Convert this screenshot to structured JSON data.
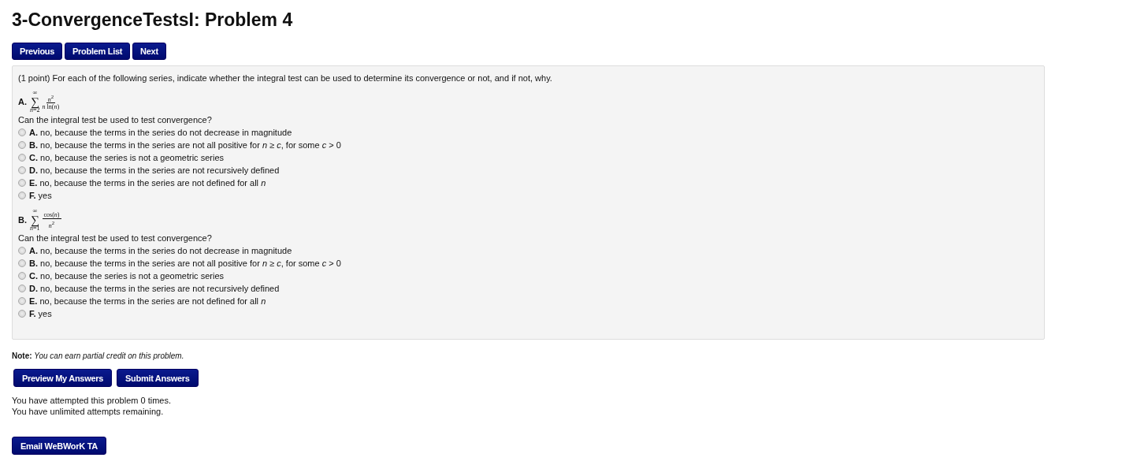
{
  "title": "3-ConvergenceTestsI: Problem 4",
  "nav_buttons": [
    "Previous",
    "Problem List",
    "Next"
  ],
  "problem": {
    "intro": "(1 point) For each of the following series, indicate whether the integral test can be used to determine its convergence or not, and if not, why.",
    "parts": [
      {
        "label": "A.",
        "symbol": "∑",
        "sum_top": "∞",
        "sum_bottom": "*n*=2",
        "numerator": "*n*$^{2}$",
        "denominator": "*n* ln(*n*)",
        "question": "Can the integral test be used to test convergence?",
        "options": [
          {
            "text": "**A.** no, because the terms in the series do not decrease in magnitude",
            "selected": false
          },
          {
            "text": "**B.** no, because the terms in the series are not all positive for *n* ≥ *c*, for some *c* > 0",
            "selected": false
          },
          {
            "text": "**C.** no, because the series is not a geometric series",
            "selected": false
          },
          {
            "text": "**D.** no, because the terms in the series are not recursively defined",
            "selected": false
          },
          {
            "text": "**E.** no, because the terms in the series are not defined for all *n*",
            "selected": false
          },
          {
            "text": "**F.** yes",
            "selected": false
          }
        ]
      },
      {
        "label": "B.",
        "symbol": "∑",
        "sum_top": "∞",
        "sum_bottom": "*n*=1",
        "numerator": "cos(*n*)",
        "denominator": "*n*$^{2}$",
        "question": "Can the integral test be used to test convergence?",
        "options": [
          {
            "text": "**A.** no, because the terms in the series do not decrease in magnitude",
            "selected": false
          },
          {
            "text": "**B.** no, because the terms in the series are not all positive for *n* ≥ *c*, for some *c* > 0",
            "selected": false
          },
          {
            "text": "**C.** no, because the series is not a geometric series",
            "selected": false
          },
          {
            "text": "**D.** no, because the terms in the series are not recursively defined",
            "selected": false
          },
          {
            "text": "**E.** no, because the terms in the series are not defined for all *n*",
            "selected": false
          },
          {
            "text": "**F.** yes",
            "selected": false
          }
        ]
      }
    ]
  },
  "note": "**Note:** *You can earn partial credit on this problem.*",
  "answer_buttons": [
    "Preview My Answers",
    "Submit Answers"
  ],
  "attempts": [
    "You have attempted this problem 0 times.",
    "You have unlimited attempts remaining."
  ],
  "email_button": "Email WeBWorK TA"
}
